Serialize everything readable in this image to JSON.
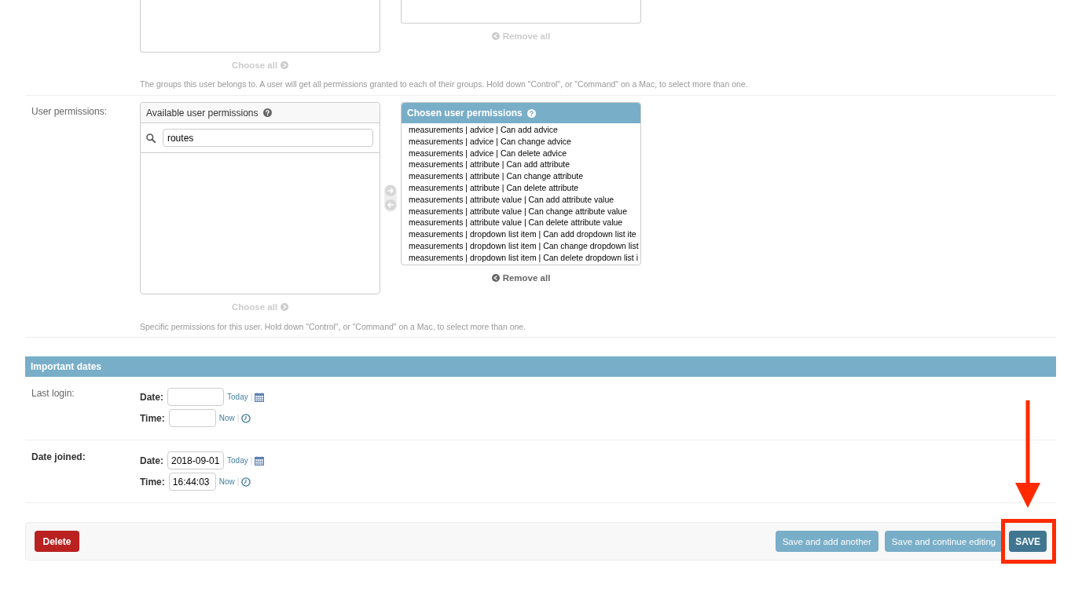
{
  "groups": {
    "choose_all": {
      "label": "Choose all",
      "disabled": true
    },
    "remove_all": {
      "label": "Remove all",
      "disabled": true
    },
    "help_text": "The groups this user belongs to. A user will get all permissions granted to each of their groups. Hold down \"Control\", or \"Command\" on a Mac, to select more than one."
  },
  "user_permissions": {
    "label": "User permissions:",
    "available": {
      "title": "Available user permissions",
      "filter": {
        "value": "routes"
      }
    },
    "transfer_buttons": [
      {
        "kind": "add",
        "disabled": true
      },
      {
        "kind": "remove",
        "disabled": true
      }
    ],
    "chosen": {
      "title": "Chosen user permissions",
      "items": [
        {
          "label": "measurements | advice | Can add advice",
          "selected": false
        },
        {
          "label": "measurements | advice | Can change advice",
          "selected": false
        },
        {
          "label": "measurements | advice | Can delete advice",
          "selected": false
        },
        {
          "label": "measurements | attribute | Can add attribute",
          "selected": false
        },
        {
          "label": "measurements | attribute | Can change attribute",
          "selected": false
        },
        {
          "label": "measurements | attribute | Can delete attribute",
          "selected": false
        },
        {
          "label": "measurements | attribute value | Can add attribute value",
          "selected": false
        },
        {
          "label": "measurements | attribute value | Can change attribute value",
          "selected": false
        },
        {
          "label": "measurements | attribute value | Can delete attribute value",
          "selected": false
        },
        {
          "label": "measurements | dropdown list item | Can add dropdown list ite",
          "selected": false
        },
        {
          "label": "measurements | dropdown list item | Can change dropdown list",
          "selected": false
        },
        {
          "label": "measurements | dropdown list item | Can delete dropdown list i",
          "selected": false
        }
      ]
    },
    "choose_all": {
      "label": "Choose all",
      "disabled": true
    },
    "remove_all": {
      "label": "Remove all",
      "disabled": false
    },
    "help_text": "Specific permissions for this user. Hold down \"Control\", or \"Command\" on a Mac, to select more than one."
  },
  "important_dates": {
    "title": "Important dates",
    "fields": [
      {
        "label": "Last login:",
        "required": false,
        "inputs": [
          {
            "kind": "date",
            "label": "Date:",
            "shortcut": "Today",
            "separator": "|"
          },
          {
            "kind": "time",
            "label": "Time:",
            "shortcut": "Now",
            "separator": "|"
          }
        ]
      },
      {
        "label": "Date joined:",
        "required": true,
        "inputs": [
          {
            "kind": "date",
            "label": "Date:",
            "value": "2018-09-01",
            "shortcut": "Today",
            "separator": "|"
          },
          {
            "kind": "time",
            "label": "Time:",
            "value": "16:44:03",
            "shortcut": "Now",
            "separator": "|"
          }
        ]
      }
    ]
  },
  "submit_row": {
    "delete_button": "Delete",
    "buttons": [
      {
        "label": "Save and add another",
        "kind": "secondary",
        "highlighted": false
      },
      {
        "label": "Save and continue editing",
        "kind": "secondary",
        "highlighted": false
      },
      {
        "label": "SAVE",
        "kind": "default",
        "highlighted": true
      }
    ]
  }
}
